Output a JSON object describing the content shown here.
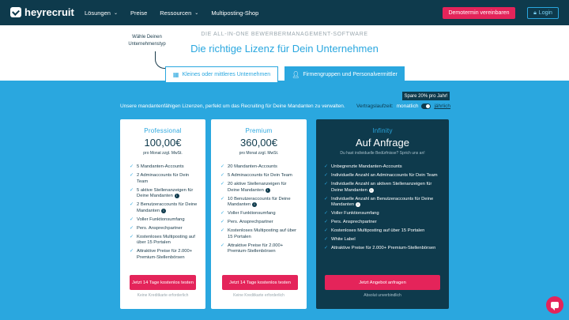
{
  "nav": {
    "brand": "heyrecruit",
    "links": [
      {
        "label": "Lösungen",
        "dropdown": true
      },
      {
        "label": "Preise",
        "dropdown": false
      },
      {
        "label": "Ressourcen",
        "dropdown": true
      },
      {
        "label": "Multiposting-Shop",
        "dropdown": false
      }
    ],
    "demo_label": "Demotermin vereinbaren",
    "login_label": "Login"
  },
  "hero": {
    "hint": "Wähle Deinen Unternehmenstyp",
    "eyebrow": "DIE ALL-IN-ONE BEWERBERMANAGEMENT-SOFTWARE",
    "title": "Die richtige Lizenz für Dein Unternehmen"
  },
  "tabs": {
    "small": "Kleines oder mittleres Unternehmen",
    "groups": "Firmengruppen und Personalvermittler",
    "active": "groups"
  },
  "controls": {
    "spare_badge": "Spare 20% pro Jahr!",
    "unlimited_text": "Unsere mandantenfähigen Lizenzen, perfekt um das Recruiting für Deine Mandanten zu verwalten.",
    "billing_label": "Vertragslaufzeit:",
    "monthly_label": "monatlich",
    "yearly_label": "jährlich",
    "selected": "yearly"
  },
  "plans": [
    {
      "name": "Professional",
      "price": "100,00€",
      "price_sub": "pro Monat zzgl. MwSt.",
      "features": [
        {
          "text": "5 Mandanten-Accounts",
          "info": false
        },
        {
          "text": "2 Adminaccounts für Dein Team",
          "info": false
        },
        {
          "text": "5 aktive Stellenanzeigen für Deine Mandanten",
          "info": true
        },
        {
          "text": "2 Benutzeraccounts für Deine Mandanten",
          "info": true
        },
        {
          "text": "Voller Funktionsumfang",
          "info": false
        },
        {
          "text": "Pers. Ansprechpartner",
          "info": false
        },
        {
          "text": "Kostenloses Multiposting auf über 15 Portalen",
          "info": false
        },
        {
          "text": "Attraktive Preise für 2.000+ Premium-Stellenbörsen",
          "info": false
        }
      ],
      "cta": "Jetzt 14 Tage kostenlos testen",
      "note": "Keine Kreditkarte erforderlich"
    },
    {
      "name": "Premium",
      "price": "360,00€",
      "price_sub": "pro Monat zzgl. MwSt.",
      "features": [
        {
          "text": "20 Mandanten-Accounts",
          "info": false
        },
        {
          "text": "5 Adminaccounts für Dein Team",
          "info": false
        },
        {
          "text": "20 aktive Stellenanzeigen für Deine Mandanten",
          "info": true
        },
        {
          "text": "10 Benutzeraccounts für Deine Mandanten",
          "info": true
        },
        {
          "text": "Voller Funktionsumfang",
          "info": false
        },
        {
          "text": "Pers. Ansprechpartner",
          "info": false
        },
        {
          "text": "Kostenloses Multiposting auf über 15 Portalen",
          "info": false
        },
        {
          "text": "Attraktive Preise für 2.000+ Premium-Stellenbörsen",
          "info": false
        }
      ],
      "cta": "Jetzt 14 Tage kostenlos testen",
      "note": "Keine Kreditkarte erforderlich"
    },
    {
      "name": "Infinity",
      "price": "Auf Anfrage",
      "price_sub": "Du hast individuelle Bedürfnisse? Sprich uns an!",
      "features": [
        {
          "text": "Unbegrenzte Mandanten-Accounts",
          "info": false
        },
        {
          "text": "Individuelle Anzahl an Adminaccounts für Dein Team",
          "info": false
        },
        {
          "text": "Individuelle Anzahl an aktiven Stellenanzeigen für Deine Mandanten",
          "info": true
        },
        {
          "text": "Individuelle Anzahl an Benutzeraccounts für Deine Mandanten",
          "info": true
        },
        {
          "text": "Voller Funktionsumfang",
          "info": false
        },
        {
          "text": "Pers. Ansprechpartner",
          "info": false
        },
        {
          "text": "Kostenloses Multiposting auf über 15 Portalen",
          "info": false
        },
        {
          "text": "White Label",
          "info": false
        },
        {
          "text": "Attraktive Preise für 2.000+ Premium-Stellenbörsen",
          "info": false
        }
      ],
      "cta": "Jetzt Angebot anfragen",
      "note": "Absolut unverbindlich"
    }
  ],
  "colors": {
    "navy": "#0e3a4c",
    "sky": "#2aa7df",
    "accent": "#e4245a"
  }
}
